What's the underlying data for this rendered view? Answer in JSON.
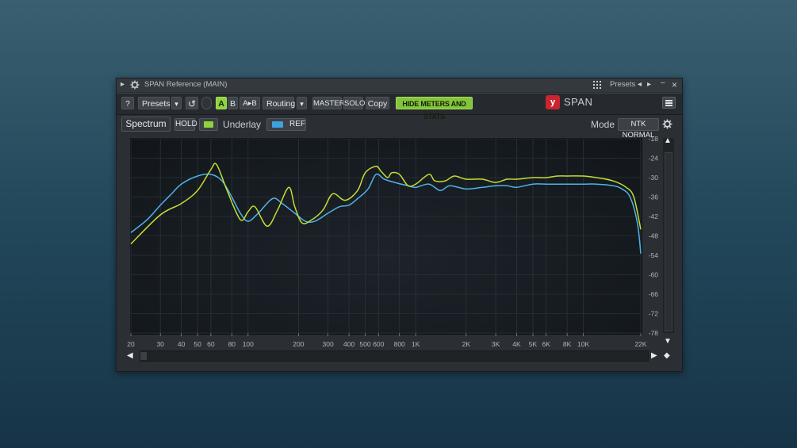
{
  "titlebar": {
    "title": "SPAN Reference (MAIN)",
    "presets_label": "Presets",
    "minimize": "–",
    "close": "×"
  },
  "toolbar": {
    "help_label": "?",
    "presets_label": "Presets",
    "presets_dropdown": "▾",
    "reset_icon": "↺",
    "a_label": "A",
    "b_label": "B",
    "ab_label": "A▸B",
    "routing_label": "Routing",
    "routing_dropdown": "▾",
    "master_label": "MASTER",
    "solo_label": "SOLO",
    "copy_label": "Copy",
    "hide_label": "HIDE METERS AND STATS",
    "logo_glyph": "y",
    "logo_text": "SPAN"
  },
  "subbar": {
    "spectrum_label": "Spectrum",
    "hold_label": "HOLD",
    "underlay_label": "Underlay",
    "ref_label": "REF",
    "mode_label": "Mode",
    "mode_value": "NTK NORMAL"
  },
  "colors": {
    "main_trace": "#c5dd33",
    "ref_trace": "#4fb2e8",
    "accent_green": "#8ed33c",
    "ref_chip": "#3ea1e0"
  },
  "chart_data": {
    "type": "line",
    "x_scale": "log",
    "xlim": [
      20,
      22000
    ],
    "ylim": [
      -78,
      -18
    ],
    "x_ticks": [
      20,
      30,
      40,
      50,
      60,
      80,
      100,
      200,
      300,
      400,
      500,
      600,
      800,
      1000,
      2000,
      3000,
      4000,
      5000,
      6000,
      8000,
      10000,
      22000
    ],
    "x_tick_labels": [
      "20",
      "30",
      "40",
      "50",
      "60",
      "80",
      "100",
      "200",
      "300",
      "400",
      "500",
      "600",
      "800",
      "1K",
      "2K",
      "3K",
      "4K",
      "5K",
      "6K",
      "8K",
      "10K",
      "22K"
    ],
    "y_ticks": [
      -18,
      -24,
      -30,
      -36,
      -42,
      -48,
      -54,
      -60,
      -66,
      -72,
      -78
    ],
    "y_tick_labels": [
      "-18",
      "-24",
      "-30",
      "-36",
      "-42",
      "-48",
      "-54",
      "-60",
      "-66",
      "-72",
      "-78"
    ],
    "grid": true,
    "series": [
      {
        "points": [
          [
            20,
            -50.5
          ],
          [
            30,
            -41.5
          ],
          [
            40,
            -38
          ],
          [
            50,
            -34
          ],
          [
            60,
            -27.5
          ],
          [
            65,
            -26
          ],
          [
            75,
            -34
          ],
          [
            90,
            -43
          ],
          [
            100,
            -40.5
          ],
          [
            110,
            -39
          ],
          [
            130,
            -45
          ],
          [
            150,
            -40
          ],
          [
            175,
            -33
          ],
          [
            190,
            -39
          ],
          [
            210,
            -44
          ],
          [
            240,
            -43
          ],
          [
            280,
            -40
          ],
          [
            320,
            -35
          ],
          [
            380,
            -37
          ],
          [
            450,
            -34
          ],
          [
            500,
            -28.5
          ],
          [
            580,
            -26.5
          ],
          [
            620,
            -28
          ],
          [
            680,
            -30
          ],
          [
            720,
            -28.5
          ],
          [
            800,
            -29
          ],
          [
            900,
            -32.5
          ],
          [
            1000,
            -32
          ],
          [
            1200,
            -29
          ],
          [
            1300,
            -31
          ],
          [
            1500,
            -31
          ],
          [
            1700,
            -29.5
          ],
          [
            2000,
            -30.5
          ],
          [
            2500,
            -30.5
          ],
          [
            3000,
            -31.5
          ],
          [
            3500,
            -30.5
          ],
          [
            4000,
            -30.5
          ],
          [
            5000,
            -30
          ],
          [
            6000,
            -30
          ],
          [
            7000,
            -29.5
          ],
          [
            8000,
            -29.5
          ],
          [
            10000,
            -29.5
          ],
          [
            12000,
            -30
          ],
          [
            15000,
            -31
          ],
          [
            18000,
            -33
          ],
          [
            20000,
            -36
          ],
          [
            22000,
            -46
          ]
        ]
      },
      {
        "points": [
          [
            20,
            -47
          ],
          [
            25,
            -43
          ],
          [
            30,
            -38.5
          ],
          [
            35,
            -35
          ],
          [
            40,
            -32
          ],
          [
            50,
            -29.5
          ],
          [
            60,
            -29
          ],
          [
            70,
            -31
          ],
          [
            80,
            -36
          ],
          [
            90,
            -41
          ],
          [
            100,
            -43.5
          ],
          [
            115,
            -41
          ],
          [
            140,
            -36.5
          ],
          [
            160,
            -38
          ],
          [
            190,
            -41
          ],
          [
            220,
            -43.5
          ],
          [
            250,
            -43.5
          ],
          [
            300,
            -41
          ],
          [
            350,
            -39
          ],
          [
            400,
            -38.5
          ],
          [
            450,
            -36.5
          ],
          [
            520,
            -33.5
          ],
          [
            580,
            -29
          ],
          [
            650,
            -30.5
          ],
          [
            750,
            -31.5
          ],
          [
            900,
            -32.5
          ],
          [
            1000,
            -33
          ],
          [
            1200,
            -32
          ],
          [
            1400,
            -34
          ],
          [
            1600,
            -32.5
          ],
          [
            2000,
            -33.5
          ],
          [
            2500,
            -33
          ],
          [
            3000,
            -32.5
          ],
          [
            3500,
            -32.5
          ],
          [
            4000,
            -33
          ],
          [
            5000,
            -32
          ],
          [
            6000,
            -32
          ],
          [
            8000,
            -32
          ],
          [
            10000,
            -32
          ],
          [
            12000,
            -32
          ],
          [
            15000,
            -32.5
          ],
          [
            17000,
            -33.5
          ],
          [
            19000,
            -36
          ],
          [
            21000,
            -44
          ],
          [
            22000,
            -53.5
          ]
        ]
      }
    ]
  }
}
